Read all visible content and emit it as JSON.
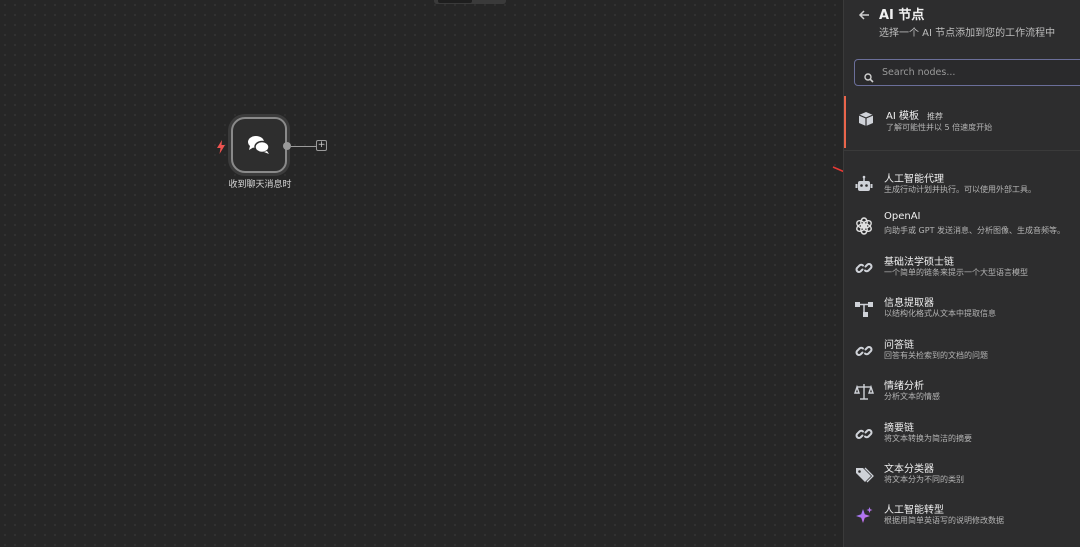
{
  "canvas": {
    "node": {
      "label": "收到聊天消息时",
      "add_label": "+"
    }
  },
  "panel": {
    "title": "AI 节点",
    "subtitle": "选择一个 AI 节点添加到您的工作流程中",
    "search": {
      "placeholder": "Search nodes...",
      "value": ""
    },
    "template": {
      "name": "AI 模板",
      "badge": "推荐",
      "desc": "了解可能性并以 5 倍速度开始"
    },
    "items": [
      {
        "name": "人工智能代理",
        "desc": "生成行动计划并执行。可以使用外部工具。",
        "icon": "robot-icon"
      },
      {
        "name": "OpenAI",
        "desc": "向助手或 GPT 发送消息、分析图像、生成音频等。",
        "icon": "openai-icon"
      },
      {
        "name": "基础法学硕士链",
        "desc": "一个简单的链条来提示一个大型语言模型",
        "icon": "link-icon"
      },
      {
        "name": "信息提取器",
        "desc": "以结构化格式从文本中提取信息",
        "icon": "extractor-icon"
      },
      {
        "name": "问答链",
        "desc": "回答有关检索到的文档的问题",
        "icon": "link-icon"
      },
      {
        "name": "情绪分析",
        "desc": "分析文本的情感",
        "icon": "scale-icon"
      },
      {
        "name": "摘要链",
        "desc": "将文本转换为简洁的摘要",
        "icon": "link-icon"
      },
      {
        "name": "文本分类器",
        "desc": "将文本分为不同的类别",
        "icon": "tags-icon"
      },
      {
        "name": "人工智能转型",
        "desc": "根据用简单英语写的说明修改数据",
        "icon": "sparkle-icon"
      }
    ]
  },
  "colors": {
    "accent": "#e9654b",
    "search_border": "#6b6f9a",
    "panel_bg": "#2d2d2e",
    "canvas_bg": "#262626"
  }
}
